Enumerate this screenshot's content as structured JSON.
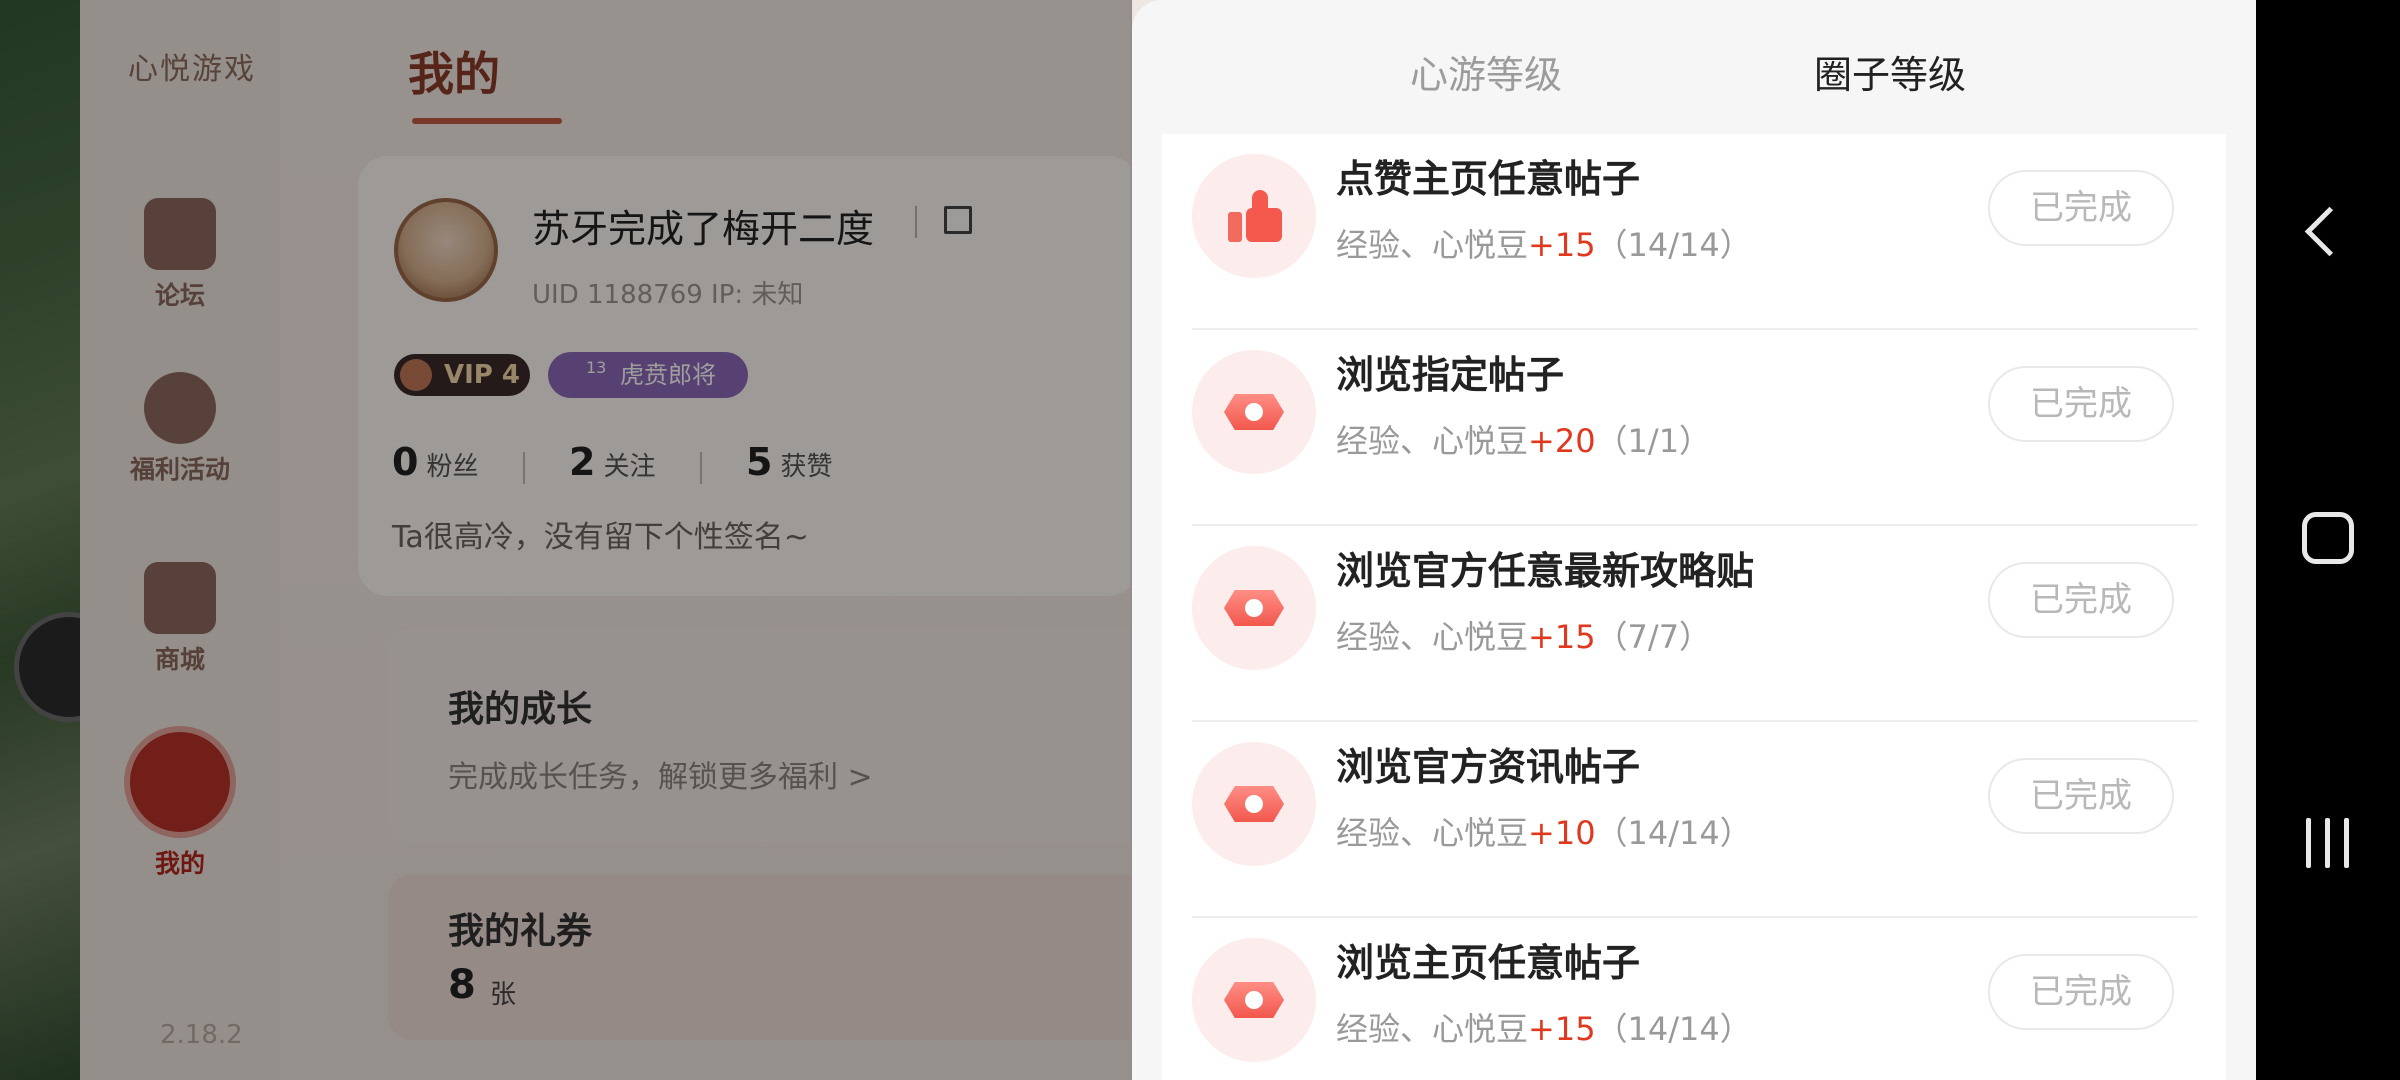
{
  "app": {
    "brand": "心悦游戏",
    "version": "2.18.2",
    "page_title": "我的",
    "nav": [
      {
        "label": "论坛",
        "icon": "forum-gate-icon"
      },
      {
        "label": "福利活动",
        "icon": "gift-bag-icon"
      },
      {
        "label": "商城",
        "icon": "shop-icon"
      },
      {
        "label": "我的",
        "icon": "profile-helmet-icon",
        "active": true
      }
    ]
  },
  "profile": {
    "name": "苏牙完成了梅开二度",
    "uid_ip": "UID 1188769   IP: 未知",
    "vip": "VIP 4",
    "rank": "虎贲郎将",
    "rank_level": "13",
    "fans_count": "0",
    "fans_label": "粉丝",
    "follow_count": "2",
    "follow_label": "关注",
    "likes_count": "5",
    "likes_label": "获赞",
    "bio": "Ta很高冷，没有留下个性签名~"
  },
  "cards": {
    "growth_title": "我的成长",
    "growth_sub": "完成成长任务，解锁更多福利 >",
    "coupon_title": "我的礼券",
    "coupon_count": "8",
    "coupon_unit": "张"
  },
  "panel": {
    "tabs": [
      {
        "label": "心游等级",
        "active": false
      },
      {
        "label": "圈子等级",
        "active": true
      }
    ],
    "tasks": [
      {
        "title": "点赞主页任意帖子",
        "reward_prefix": "经验、心悦豆",
        "points": "+15",
        "progress": "（14/14）",
        "status": "已完成",
        "icon": "thumb-up-icon"
      },
      {
        "title": "浏览指定帖子",
        "reward_prefix": "经验、心悦豆",
        "points": "+20",
        "progress": "（1/1）",
        "status": "已完成",
        "icon": "eye-hexagon-icon"
      },
      {
        "title": "浏览官方任意最新攻略贴",
        "reward_prefix": "经验、心悦豆",
        "points": "+15",
        "progress": "（7/7）",
        "status": "已完成",
        "icon": "eye-hexagon-icon"
      },
      {
        "title": "浏览官方资讯帖子",
        "reward_prefix": "经验、心悦豆",
        "points": "+10",
        "progress": "（14/14）",
        "status": "已完成",
        "icon": "eye-hexagon-icon"
      },
      {
        "title": "浏览主页任意帖子",
        "reward_prefix": "经验、心悦豆",
        "points": "+15",
        "progress": "（14/14）",
        "status": "已完成",
        "icon": "eye-hexagon-icon"
      }
    ]
  },
  "colors": {
    "accent_red": "#e0381f",
    "icon_bg": "#fdecec",
    "done_text": "#b8b8b8"
  }
}
